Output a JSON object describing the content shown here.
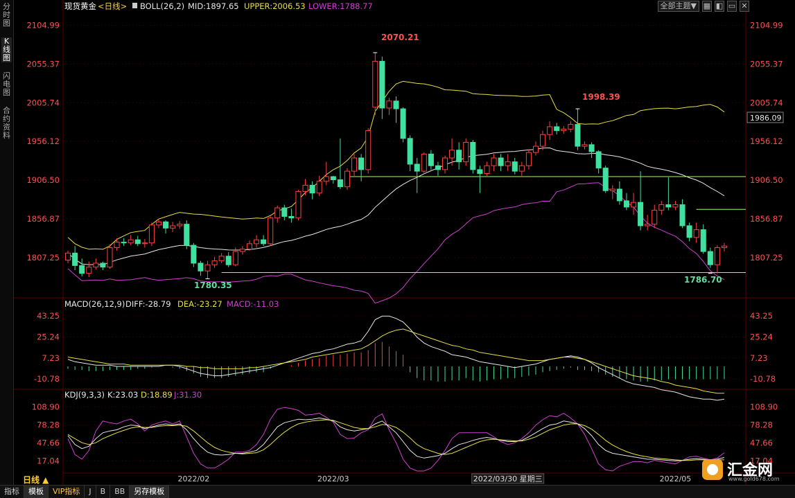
{
  "nav": {
    "items": [
      "分时图",
      "K线图",
      "闪电图",
      "合约资料"
    ],
    "active": 1
  },
  "toolbar": {
    "theme_label": "全部主题▼",
    "buttons": [
      "▦",
      "◧",
      "▭",
      "✕"
    ]
  },
  "main_panel": {
    "header": {
      "symbol": "现货黄金",
      "period": "<日线>",
      "boll_label": "BOLL(26,2)",
      "mid": "MID:1897.65",
      "upper": "UPPER:2006.53",
      "lower": "LOWER:1788.77"
    },
    "yticks": [
      "2104.99",
      "2055.37",
      "2005.74",
      "1956.12",
      "1906.50",
      "1856.87",
      "1807.25"
    ],
    "current_price": "1986.09",
    "annotations": {
      "high": "2070.21",
      "high2": "1998.39",
      "low_left": "1780.35",
      "low_right": "1786.70"
    }
  },
  "macd_panel": {
    "header": {
      "name": "MACD(26,12,9)",
      "diff": "DIFF:-28.79",
      "dea": "DEA:-23.27",
      "macd": "MACD:-11.03"
    },
    "yticks": [
      "43.25",
      "25.24",
      "7.23",
      "-10.78"
    ]
  },
  "kdj_panel": {
    "header": {
      "name": "KDJ(9,3,3)",
      "k": "K:23.03",
      "d": "D:18.89",
      "j": "J:31.30"
    },
    "yticks": [
      "108.90",
      "78.28",
      "47.66",
      "17.04"
    ]
  },
  "xaxis": {
    "labels": [
      "2022/02",
      "2022/03",
      "2022/03/30 星期三",
      "2022/05"
    ],
    "period_button": "日线 ▲"
  },
  "bottom_tabs": [
    "指标",
    "模板",
    "VIP指标",
    "J",
    "B",
    "BB",
    "另存模板"
  ],
  "selected_bottom_tab": 1,
  "logo": {
    "name": "汇金网",
    "url": "www.gold678.com"
  },
  "colors": {
    "up": "#ff4040",
    "down": "#40e0a0",
    "mid": "#e8e8e8",
    "upper": "#e8e040",
    "lower": "#d040d0",
    "label_red": "#ff5050",
    "label_green": "#60e0a0",
    "axis": "#ff5050"
  },
  "chart_data": {
    "type": "candlestick",
    "price": {
      "ylim": [
        1760,
        2118
      ],
      "ticks": [
        2104.99,
        2055.37,
        2005.74,
        1956.12,
        1906.5,
        1856.87,
        1807.25
      ],
      "candles": [
        [
          1804,
          1813,
          1800,
          1816
        ],
        [
          1813,
          1797,
          1791,
          1822
        ],
        [
          1797,
          1787,
          1783,
          1806
        ],
        [
          1787,
          1795,
          1782,
          1802
        ],
        [
          1795,
          1800,
          1792,
          1806
        ],
        [
          1800,
          1795,
          1791,
          1802
        ],
        [
          1795,
          1820,
          1793,
          1824
        ],
        [
          1820,
          1827,
          1816,
          1832
        ],
        [
          1827,
          1826,
          1822,
          1832
        ],
        [
          1826,
          1830,
          1823,
          1836
        ],
        [
          1830,
          1825,
          1822,
          1835
        ],
        [
          1825,
          1826,
          1820,
          1831
        ],
        [
          1826,
          1849,
          1822,
          1852
        ],
        [
          1849,
          1853,
          1845,
          1857
        ],
        [
          1853,
          1845,
          1838,
          1855
        ],
        [
          1845,
          1848,
          1840,
          1853
        ],
        [
          1848,
          1850,
          1844,
          1854
        ],
        [
          1850,
          1823,
          1818,
          1855
        ],
        [
          1823,
          1800,
          1795,
          1826
        ],
        [
          1800,
          1790,
          1784,
          1803
        ],
        [
          1790,
          1798,
          1780,
          1803
        ],
        [
          1798,
          1803,
          1794,
          1808
        ],
        [
          1803,
          1809,
          1800,
          1813
        ],
        [
          1809,
          1798,
          1795,
          1814
        ],
        [
          1798,
          1815,
          1796,
          1820
        ],
        [
          1815,
          1818,
          1811,
          1822
        ],
        [
          1818,
          1825,
          1816,
          1829
        ],
        [
          1825,
          1830,
          1820,
          1836
        ],
        [
          1830,
          1825,
          1822,
          1836
        ],
        [
          1825,
          1858,
          1822,
          1860
        ],
        [
          1858,
          1871,
          1852,
          1874
        ],
        [
          1871,
          1860,
          1855,
          1875
        ],
        [
          1860,
          1858,
          1852,
          1870
        ],
        [
          1858,
          1892,
          1855,
          1894
        ],
        [
          1892,
          1900,
          1887,
          1908
        ],
        [
          1900,
          1890,
          1882,
          1905
        ],
        [
          1890,
          1905,
          1886,
          1912
        ],
        [
          1905,
          1911,
          1900,
          1930
        ],
        [
          1911,
          1907,
          1902,
          1912
        ],
        [
          1907,
          1898,
          1895,
          1960
        ],
        [
          1898,
          1918,
          1894,
          1922
        ],
        [
          1918,
          1935,
          1912,
          1940
        ],
        [
          1935,
          1920,
          1905,
          1940
        ],
        [
          1920,
          1970,
          1915,
          1973
        ],
        [
          2000,
          2059,
          1990,
          2070
        ],
        [
          2059,
          1999,
          1985,
          2065
        ],
        [
          1999,
          2008,
          1990,
          2012
        ],
        [
          2008,
          1998,
          1980,
          2014
        ],
        [
          1998,
          1960,
          1955,
          2000
        ],
        [
          1960,
          1927,
          1918,
          1964
        ],
        [
          1927,
          1918,
          1890,
          1935
        ],
        [
          1918,
          1940,
          1914,
          1942
        ],
        [
          1940,
          1925,
          1920,
          1945
        ],
        [
          1925,
          1920,
          1912,
          1930
        ],
        [
          1920,
          1935,
          1915,
          1938
        ],
        [
          1935,
          1945,
          1925,
          1960
        ],
        [
          1945,
          1930,
          1920,
          1955
        ],
        [
          1930,
          1955,
          1925,
          1960
        ],
        [
          1955,
          1920,
          1915,
          1958
        ],
        [
          1920,
          1915,
          1890,
          1925
        ],
        [
          1915,
          1925,
          1912,
          1930
        ],
        [
          1925,
          1935,
          1918,
          1940
        ],
        [
          1935,
          1925,
          1918,
          1940
        ],
        [
          1925,
          1930,
          1918,
          1940
        ],
        [
          1930,
          1918,
          1914,
          1935
        ],
        [
          1918,
          1925,
          1912,
          1930
        ],
        [
          1925,
          1942,
          1920,
          1946
        ],
        [
          1942,
          1950,
          1938,
          1956
        ],
        [
          1950,
          1965,
          1945,
          1970
        ],
        [
          1965,
          1975,
          1958,
          1982
        ],
        [
          1975,
          1970,
          1965,
          1980
        ],
        [
          1970,
          1972,
          1966,
          1976
        ],
        [
          1972,
          1978,
          1968,
          1982
        ],
        [
          1978,
          1950,
          1945,
          1998
        ],
        [
          1950,
          1952,
          1946,
          1956
        ],
        [
          1952,
          1943,
          1935,
          1955
        ],
        [
          1943,
          1922,
          1915,
          1945
        ],
        [
          1922,
          1893,
          1890,
          1925
        ],
        [
          1893,
          1895,
          1882,
          1900
        ],
        [
          1895,
          1880,
          1875,
          1905
        ],
        [
          1880,
          1872,
          1868,
          1890
        ],
        [
          1872,
          1878,
          1862,
          1890
        ],
        [
          1878,
          1848,
          1842,
          1918
        ],
        [
          1848,
          1850,
          1842,
          1862
        ],
        [
          1850,
          1868,
          1845,
          1875
        ],
        [
          1868,
          1875,
          1862,
          1880
        ],
        [
          1875,
          1872,
          1868,
          1910
        ],
        [
          1872,
          1875,
          1868,
          1880
        ],
        [
          1875,
          1848,
          1845,
          1882
        ],
        [
          1848,
          1833,
          1828,
          1852
        ],
        [
          1833,
          1843,
          1826,
          1852
        ],
        [
          1843,
          1815,
          1812,
          1850
        ],
        [
          1815,
          1798,
          1794,
          1820
        ],
        [
          1798,
          1820,
          1787,
          1823
        ],
        [
          1820,
          1822,
          1815,
          1826
        ]
      ]
    },
    "macd": {
      "ylim": [
        -16,
        48
      ],
      "ticks": [
        43.25,
        25.24,
        7.23,
        -10.78
      ],
      "hist": [
        -2,
        -3,
        -3,
        -4,
        -4,
        -4,
        -3,
        -3,
        -3,
        -3,
        -2,
        -2,
        -1,
        0,
        0,
        -1,
        -2,
        -4,
        -6,
        -9,
        -10,
        -10,
        -10,
        -9,
        -8,
        -7,
        -6,
        -5,
        -5,
        -2,
        0,
        0,
        1,
        3,
        5,
        6,
        7,
        9,
        10,
        10,
        11,
        12,
        12,
        14,
        20,
        21,
        17,
        13,
        10,
        -5,
        -10,
        -12,
        -12,
        -13,
        -13,
        -12,
        -12,
        -10,
        -12,
        -13,
        -12,
        -11,
        -11,
        -10,
        -10,
        -9,
        -8,
        -7,
        -5,
        -4,
        -3,
        -2,
        -1,
        -3,
        -3,
        -4,
        -5,
        -7,
        -9,
        -10,
        -11,
        -12,
        -13,
        -13,
        -12,
        -12,
        -11,
        -11,
        -11,
        -11,
        -11,
        -11,
        -11,
        -11,
        -11
      ],
      "dea": [
        8,
        7,
        6,
        5,
        4,
        3,
        2,
        2,
        2,
        1,
        1,
        1,
        1,
        1,
        1,
        1,
        1,
        0,
        0,
        -1,
        -1,
        -2,
        -2,
        -2,
        -2,
        -2,
        -1,
        -1,
        0,
        1,
        2,
        3,
        4,
        5,
        6,
        8,
        9,
        10,
        11,
        12,
        13,
        14,
        15,
        18,
        22,
        26,
        29,
        31,
        32,
        30,
        28,
        26,
        24,
        22,
        20,
        18,
        17,
        15,
        14,
        12,
        11,
        10,
        9,
        8,
        7,
        6,
        5,
        5,
        5,
        6,
        7,
        8,
        8,
        7,
        6,
        4,
        2,
        0,
        -2,
        -4,
        -6,
        -8,
        -9,
        -10,
        -11,
        -13,
        -14,
        -16,
        -17,
        -18,
        -19,
        -21,
        -22,
        -23,
        -23
      ],
      "diff": [
        6,
        4,
        3,
        2,
        1,
        1,
        1,
        0,
        0,
        0,
        0,
        0,
        0,
        0,
        1,
        1,
        0,
        -2,
        -4,
        -6,
        -7,
        -8,
        -8,
        -7,
        -6,
        -5,
        -4,
        -3,
        -2,
        -1,
        1,
        3,
        5,
        7,
        9,
        11,
        12,
        14,
        15,
        17,
        19,
        20,
        22,
        30,
        40,
        43,
        43,
        41,
        38,
        32,
        25,
        20,
        17,
        15,
        13,
        10,
        9,
        8,
        6,
        4,
        3,
        2,
        1,
        0,
        -1,
        0,
        1,
        2,
        4,
        6,
        7,
        8,
        9,
        8,
        6,
        3,
        -1,
        -4,
        -7,
        -10,
        -13,
        -15,
        -16,
        -17,
        -18,
        -20,
        -21,
        -22,
        -24,
        -26,
        -27,
        -28,
        -28,
        -29,
        -28
      ]
    },
    "kdj": {
      "ylim": [
        0,
        120
      ],
      "ticks": [
        108.9,
        78.28,
        47.66,
        17.04
      ],
      "k": [
        60,
        45,
        38,
        42,
        55,
        65,
        68,
        70,
        75,
        78,
        77,
        72,
        75,
        78,
        80,
        78,
        80,
        70,
        55,
        42,
        32,
        28,
        27,
        28,
        30,
        30,
        32,
        35,
        45,
        60,
        75,
        82,
        85,
        88,
        87,
        88,
        90,
        88,
        85,
        75,
        70,
        68,
        70,
        72,
        80,
        85,
        75,
        65,
        50,
        35,
        25,
        22,
        24,
        26,
        30,
        38,
        45,
        48,
        52,
        55,
        57,
        55,
        52,
        50,
        50,
        52,
        58,
        65,
        72,
        78,
        80,
        85,
        83,
        80,
        72,
        60,
        45,
        35,
        30,
        28,
        26,
        24,
        22,
        20,
        20,
        19,
        18,
        17,
        18,
        20,
        21,
        20,
        19,
        20,
        23
      ],
      "d": [
        62,
        55,
        48,
        45,
        48,
        55,
        60,
        65,
        69,
        73,
        75,
        74,
        74,
        76,
        77,
        77,
        78,
        76,
        68,
        58,
        48,
        40,
        35,
        32,
        30,
        29,
        30,
        31,
        36,
        45,
        56,
        66,
        74,
        80,
        83,
        85,
        86,
        87,
        86,
        82,
        78,
        74,
        72,
        72,
        75,
        79,
        78,
        74,
        66,
        56,
        45,
        38,
        34,
        30,
        28,
        30,
        35,
        40,
        45,
        50,
        53,
        54,
        53,
        52,
        51,
        51,
        54,
        58,
        64,
        70,
        74,
        78,
        80,
        80,
        77,
        71,
        62,
        52,
        44,
        38,
        33,
        29,
        26,
        24,
        22,
        21,
        20,
        19,
        18,
        18,
        19,
        19,
        19,
        19,
        19
      ],
      "j": [
        55,
        28,
        20,
        35,
        68,
        85,
        82,
        80,
        85,
        88,
        80,
        68,
        78,
        82,
        85,
        80,
        85,
        58,
        30,
        12,
        5,
        5,
        12,
        20,
        32,
        32,
        35,
        45,
        62,
        88,
        105,
        108,
        106,
        103,
        95,
        96,
        98,
        91,
        83,
        62,
        55,
        56,
        65,
        70,
        90,
        97,
        70,
        48,
        20,
        5,
        0,
        0,
        5,
        18,
        35,
        55,
        65,
        65,
        65,
        65,
        65,
        58,
        50,
        45,
        48,
        55,
        65,
        78,
        87,
        94,
        92,
        98,
        90,
        80,
        62,
        38,
        12,
        2,
        0,
        8,
        12,
        16,
        16,
        14,
        18,
        16,
        14,
        12,
        18,
        24,
        25,
        22,
        19,
        22,
        31
      ]
    },
    "xaxis": {
      "label_indices": {
        "2022/02": 18,
        "2022/03": 38,
        "2022/03/30 星期三": 63,
        "2022/05": 87
      }
    }
  }
}
